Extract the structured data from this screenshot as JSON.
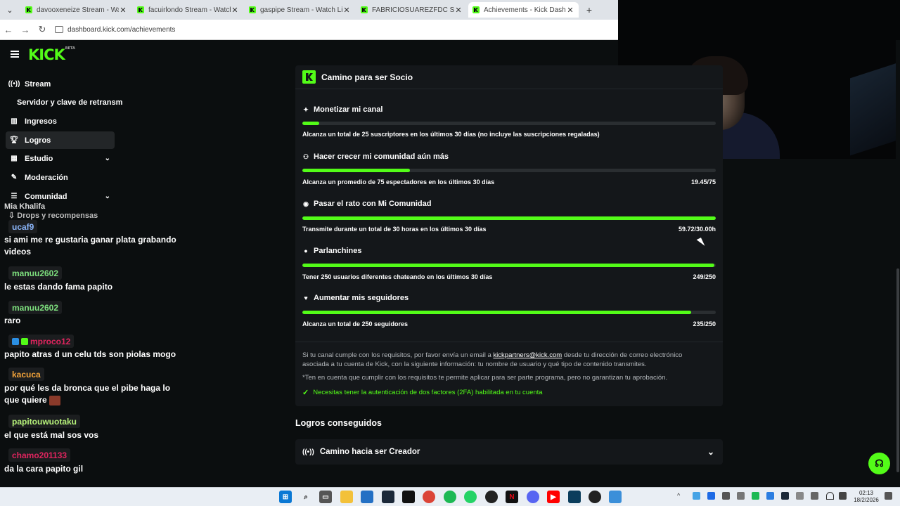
{
  "browser": {
    "tabs": [
      {
        "title": "davooxeneize Stream - Watch L",
        "active": false
      },
      {
        "title": "facuirlondo Stream - Watch Liv",
        "active": false
      },
      {
        "title": "gaspipe Stream - Watch Live or",
        "active": false
      },
      {
        "title": "FABRICIOSUAREZFDC Stream -",
        "active": false
      },
      {
        "title": "Achievements - Kick Dashboard",
        "active": true
      }
    ],
    "new_tab": "+",
    "url": "dashboard.kick.com/achievements"
  },
  "sidebar": {
    "logo": "KICK",
    "logo_beta": "BETA",
    "items": [
      {
        "label": "Stream",
        "icon": "broadcast-icon"
      },
      {
        "label": "Servidor y clave de retransm",
        "icon": ""
      },
      {
        "label": "Ingresos",
        "icon": "chart-icon"
      },
      {
        "label": "Logros",
        "icon": "trophy-icon"
      },
      {
        "label": "Estudio",
        "icon": "grid-icon"
      },
      {
        "label": "Moderación",
        "icon": "wrench-icon"
      },
      {
        "label": "Comunidad",
        "icon": "community-icon"
      },
      {
        "label": "Drops y recompensas",
        "icon": "drop-icon"
      }
    ]
  },
  "chat": {
    "cut_name": "Mia Khalifa",
    "messages": [
      {
        "user": "ucaf9",
        "color": "#8ab4f8",
        "text": ""
      },
      {
        "user": "",
        "color": "",
        "text": "si ami me re gustaria ganar plata grabando videos"
      },
      {
        "user": "manuu2602",
        "color": "#7ee07e",
        "text": "le estas dando fama papito"
      },
      {
        "user": "manuu2602",
        "color": "#7ee07e",
        "text": "raro"
      },
      {
        "user": "mproco12",
        "color": "#e0245e",
        "text": "papito atras d un celu tds son piolas mogo"
      },
      {
        "user": "kacuca",
        "color": "#f2a33a",
        "text": "por qué les da bronca que el pibe haga lo que quiere"
      },
      {
        "user": "papitouwuotaku",
        "color": "#b6f27a",
        "text": "el que está mal sos vos"
      },
      {
        "user": "chamo201133",
        "color": "#e0245e",
        "text": "da la cara papito gil"
      }
    ]
  },
  "main": {
    "card_title": "Camino para ser Socio",
    "goals": [
      {
        "title": "Monetizar mi canal",
        "icon": "sparkle-icon",
        "desc": "Alcanza un total de 25 suscriptores en los últimos 30 días (no incluye las suscripciones regaladas)",
        "value": "",
        "progress": 0.04
      },
      {
        "title": "Hacer crecer mi comunidad aún más",
        "icon": "users-icon",
        "desc": "Alcanza un promedio de 75 espectadores en los últimos 30 días",
        "value": "19.45/75",
        "progress": 0.26
      },
      {
        "title": "Pasar el rato con Mi Comunidad",
        "icon": "broadcast-icon",
        "desc": "Transmite durante un total de 30 horas en los últimos 30 días",
        "value": "59.72/30.00h",
        "progress": 1.0
      },
      {
        "title": "Parlanchines",
        "icon": "chat-icon",
        "desc": "Tener 250 usuarios diferentes chateando en los últimos 30 días",
        "value": "249/250",
        "progress": 0.996
      },
      {
        "title": "Aumentar mis seguidores",
        "icon": "heart-icon",
        "desc": "Alcanza un total de 250 seguidores",
        "value": "235/250",
        "progress": 0.94
      }
    ],
    "info_pre": "Si tu canal cumple con los requisitos, por favor envía un email a",
    "info_email": "kickpartners@kick.com",
    "info_post": "desde tu dirección de correo electrónico asociada a tu cuenta de Kick, con la siguiente información: tu nombre de usuario y qué tipo de contenido transmites.",
    "info_note": "*Ten en cuenta que cumplir con los requisitos te permite aplicar para ser parte programa, pero no garantizan tu aprobación.",
    "twofa": "Necesitas tener la autenticación de dos factores (2FA) habilitada en tu cuenta",
    "achieved_title": "Logros conseguidos",
    "achieved_item": "Camino hacia ser Creador"
  },
  "taskbar": {
    "time": "02:13",
    "date": "18/2/2026"
  },
  "colors": {
    "accent": "#53fc18",
    "bg": "#0b0e0f",
    "card": "#14171a"
  }
}
